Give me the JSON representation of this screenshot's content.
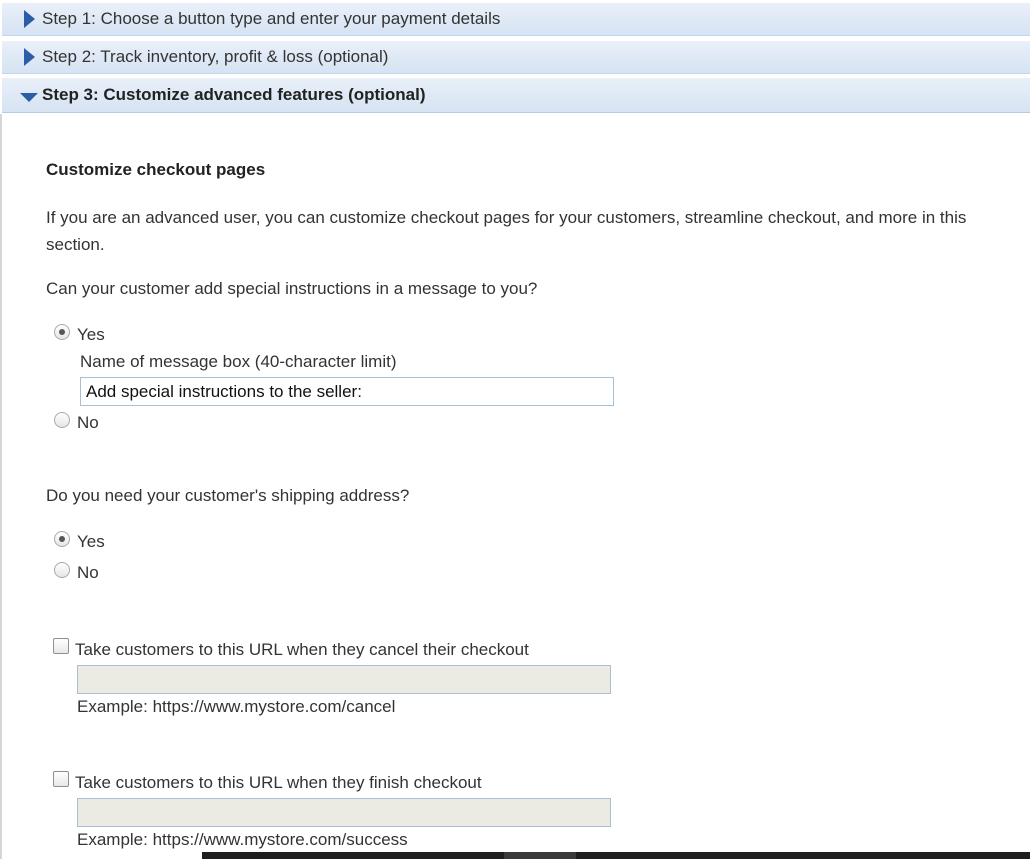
{
  "steps": [
    {
      "label": "Step 1: Choose a button type and enter your payment details",
      "expanded": false
    },
    {
      "label": "Step 2: Track inventory, profit & loss (optional)",
      "expanded": false
    },
    {
      "label": "Step 3: Customize advanced features (optional)",
      "expanded": true
    }
  ],
  "section": {
    "title": "Customize checkout pages",
    "intro": "If you are an advanced user, you can customize checkout pages for your customers, streamline checkout, and more in this section."
  },
  "instructions": {
    "question": "Can your customer add special instructions in a message to you?",
    "yes_label": "Yes",
    "no_label": "No",
    "selected": "Yes",
    "box_name_label": "Name of message box (40-character limit)",
    "box_name_value": "Add special instructions to the seller:"
  },
  "shipping": {
    "question": "Do you need your customer's shipping address?",
    "yes_label": "Yes",
    "no_label": "No",
    "selected": "Yes"
  },
  "cancel_url": {
    "label": "Take customers to this URL when they cancel their checkout",
    "checked": false,
    "value": "",
    "example": "Example: https://www.mystore.com/cancel"
  },
  "finish_url": {
    "label": "Take customers to this URL when they finish checkout",
    "checked": false,
    "value": "",
    "example": "Example: https://www.mystore.com/success"
  },
  "colors": {
    "header_bg": "#dfe8f5",
    "arrow": "#2a5ea8",
    "field_border": "#a8bfd8",
    "disabled_field": "#ebebe4"
  }
}
